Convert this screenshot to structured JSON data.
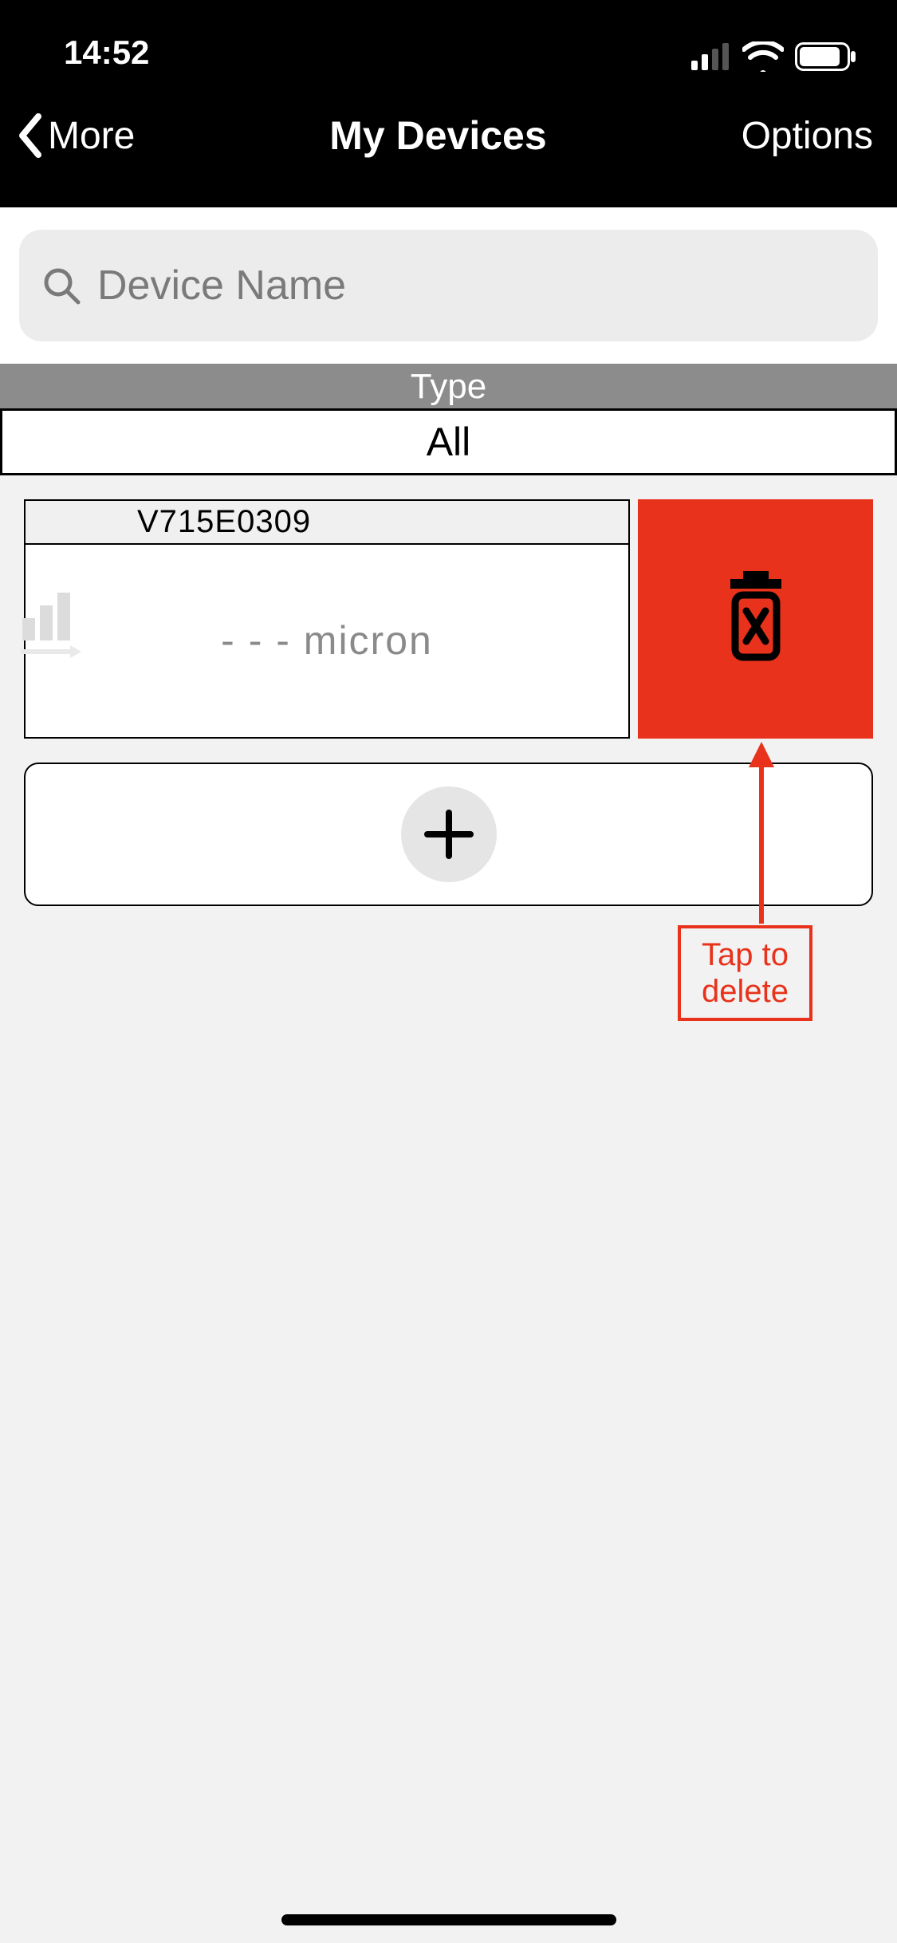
{
  "statusbar": {
    "time": "14:52"
  },
  "nav": {
    "back_label": "More",
    "title": "My Devices",
    "options_label": "Options"
  },
  "search": {
    "placeholder": "Device Name"
  },
  "filter": {
    "header": "Type",
    "value": "All"
  },
  "device": {
    "id": "V715E0309",
    "reading": "- - -  micron"
  },
  "annotation": {
    "text_line1": "Tap to",
    "text_line2": "delete"
  },
  "colors": {
    "delete_red": "#e8321b"
  }
}
